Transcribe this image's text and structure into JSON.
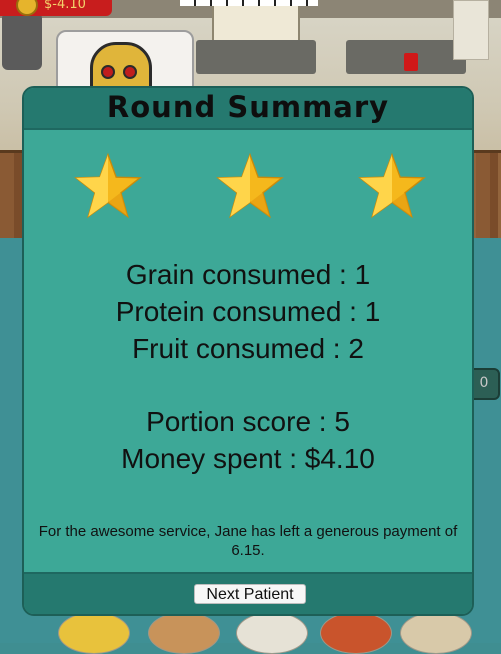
{
  "hud": {
    "money_display": "$-4.10",
    "side_tag": "0"
  },
  "modal": {
    "title": "Round Summary",
    "stars": [
      {
        "icon": "gold-star",
        "earned": true
      },
      {
        "icon": "gold-star",
        "earned": true
      },
      {
        "icon": "gold-star",
        "earned": true
      }
    ],
    "stats": {
      "grain": "Grain consumed : 1",
      "protein": "Protein consumed : 1",
      "fruit": "Fruit consumed : 2",
      "portion": "Portion score : 5",
      "money": "Money spent : $4.10"
    },
    "message": "For the awesome service, Jane has left a generous payment of 6.15.",
    "next_button": "Next Patient"
  },
  "colors": {
    "modal_bg": "#3da897",
    "modal_header": "#25796f",
    "star_gold": "#f5b81c",
    "badge_red": "#c81d1d"
  }
}
